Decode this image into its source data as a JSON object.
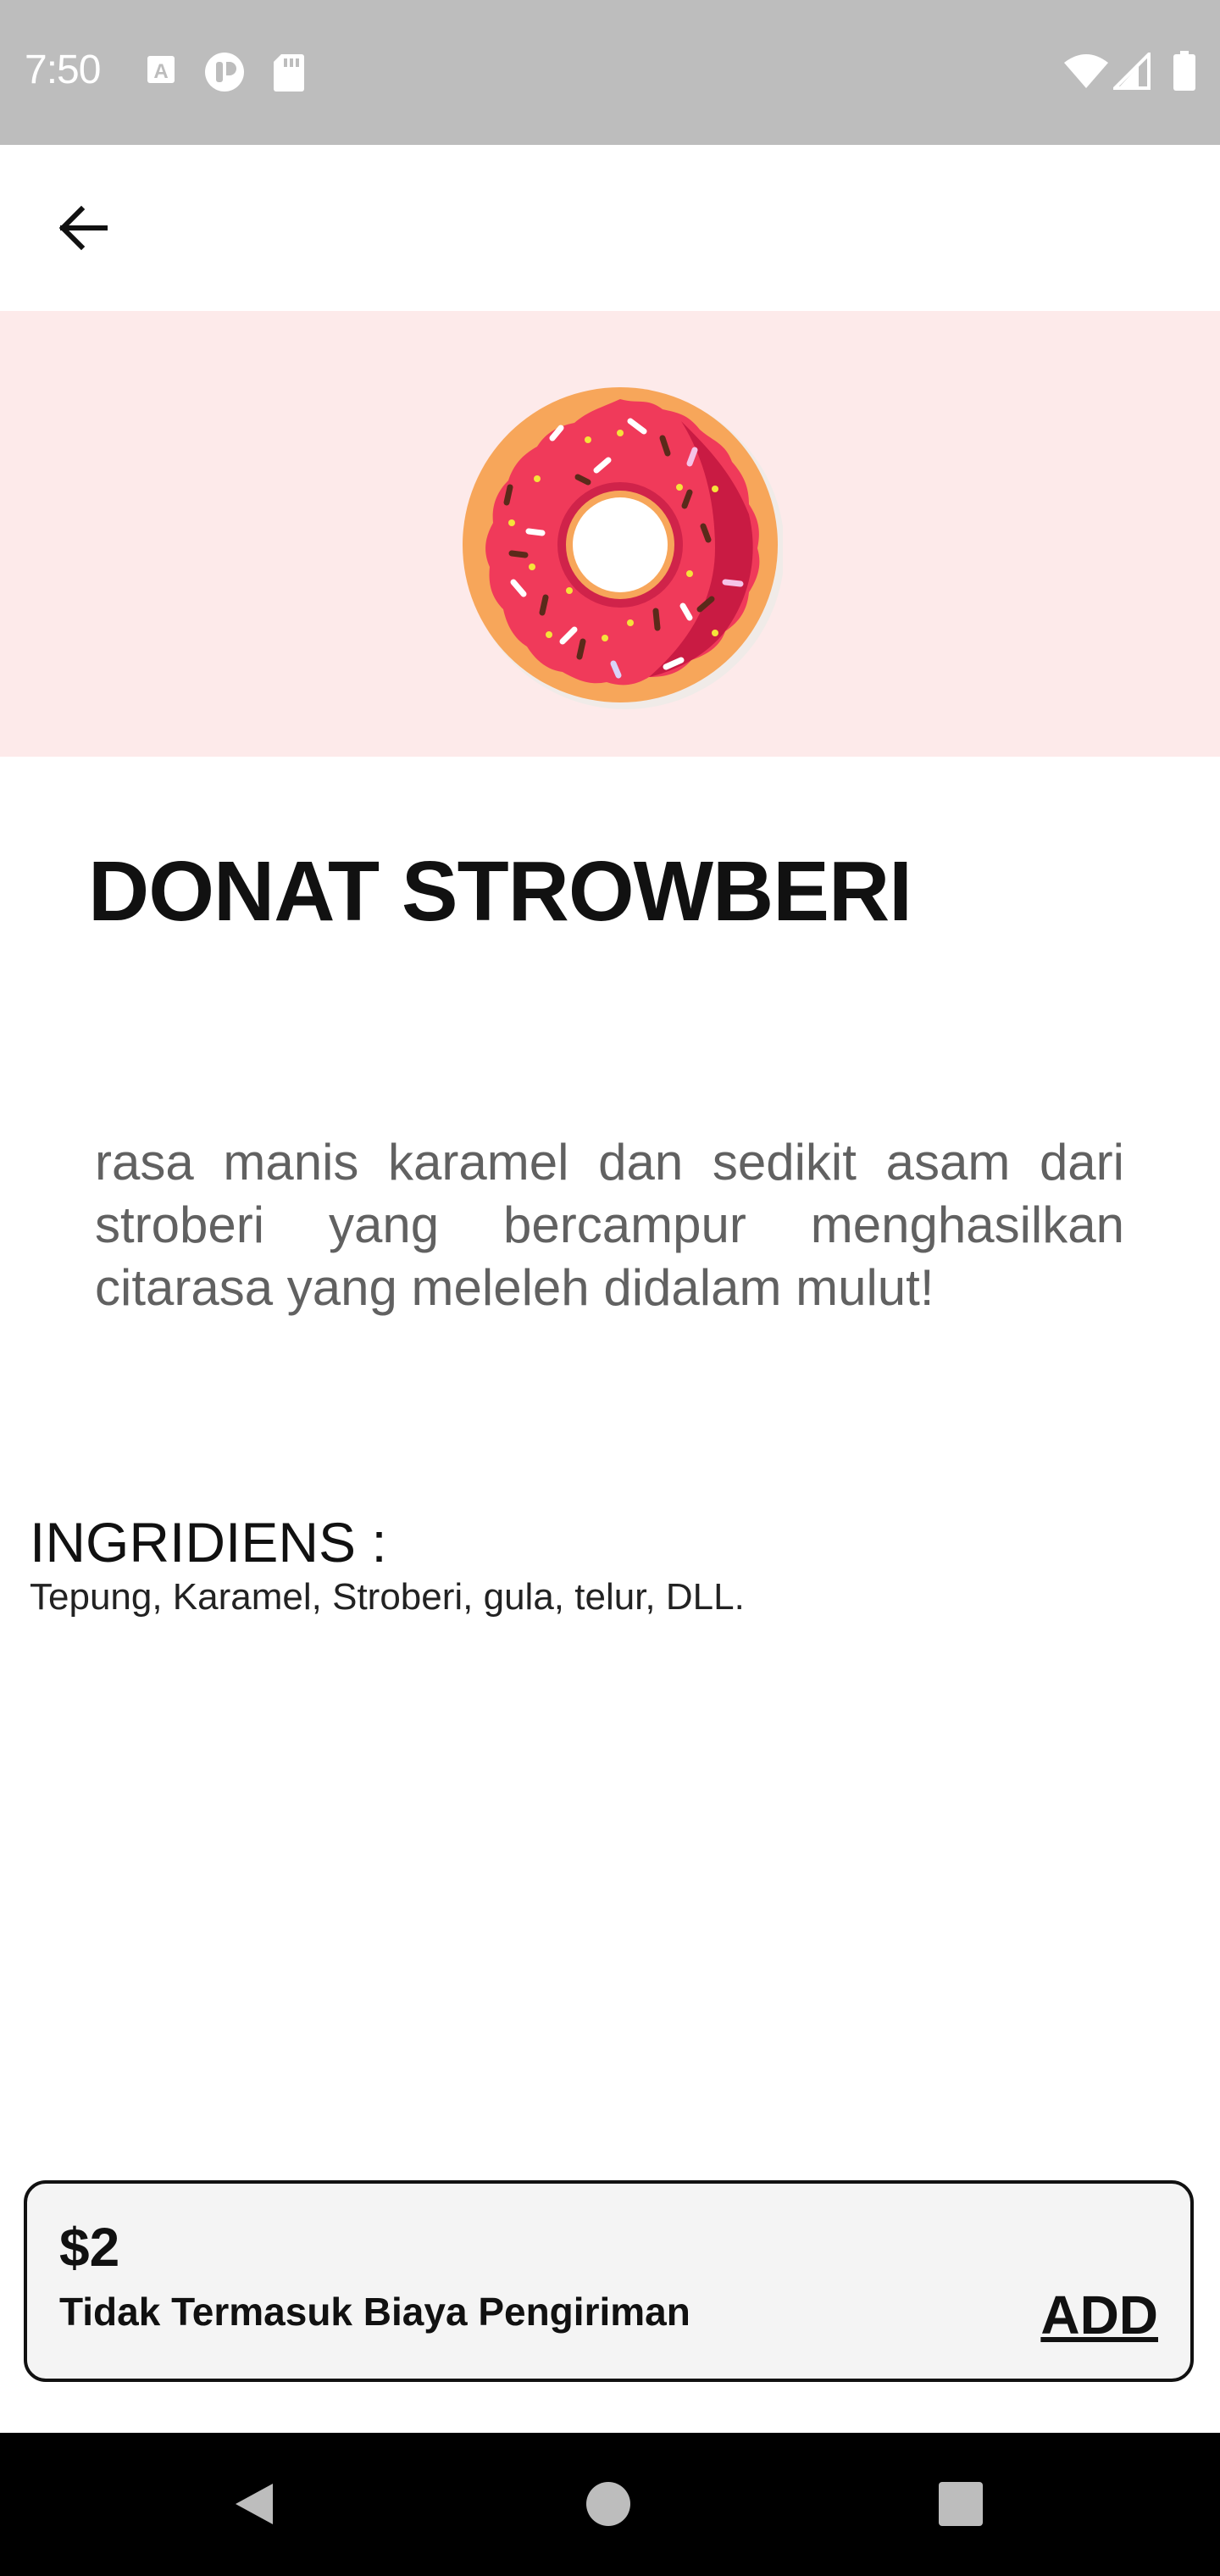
{
  "status_bar": {
    "time": "7:50",
    "left_icons": [
      "a-icon",
      "circle-app-icon",
      "sd-card-icon"
    ],
    "right_icons": [
      "wifi-icon",
      "signal-icon",
      "battery-icon"
    ]
  },
  "app_bar": {
    "back_icon": "arrow-left-icon"
  },
  "hero": {
    "image": "strawberry-donut",
    "background": "#fdeaea"
  },
  "product": {
    "title": "DONAT STROWBERI",
    "description": "rasa manis karamel dan sedikit asam dari stroberi yang bercampur menghasilkan citarasa yang meleleh didalam mulut!",
    "ingredients_title": "INGRIDIENS :",
    "ingredients": "Tepung, Karamel, Stroberi, gula, telur, DLL."
  },
  "bottom_card": {
    "price": "$2",
    "shipping_note": "Tidak Termasuk Biaya Pengiriman",
    "add_label": "ADD"
  },
  "nav_bar": {
    "buttons": [
      "back-triangle-icon",
      "home-circle-icon",
      "recents-square-icon"
    ]
  }
}
